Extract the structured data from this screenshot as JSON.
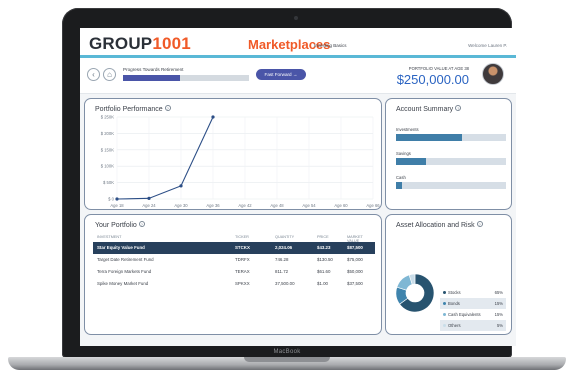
{
  "device": {
    "brand_label": "MacBook"
  },
  "header": {
    "logo_text": "GROUP",
    "logo_accent": "1001",
    "app_title": "Marketplaces",
    "app_subtitle": "Investing Basics",
    "welcome": "Welcome Lauren P."
  },
  "progress": {
    "label": "Progress Towards Retirement",
    "fraction": 0.45,
    "fast_forward_label": "Fast Forward →",
    "portfolio_value_label": "PORTFOLIO VALUE AT AGE 38",
    "portfolio_value": "$250,000.00"
  },
  "performance": {
    "title": "Portfolio Performance",
    "chart_data": {
      "type": "line",
      "x": [
        "Age 18",
        "Age 24",
        "Age 30",
        "Age 36",
        "Age 42",
        "Age 48",
        "Age 54",
        "Age 60",
        "Age 66"
      ],
      "series": [
        {
          "values": [
            0,
            2000,
            40000,
            250000
          ]
        }
      ],
      "yticks": [
        "$ 0",
        "$ 50K",
        "$ 100K",
        "$ 150K",
        "$ 200K",
        "$ 250K"
      ],
      "ylim": [
        0,
        250000
      ],
      "grid": true,
      "color": "#2c4e86"
    }
  },
  "summary": {
    "title": "Account Summary",
    "items": [
      {
        "label": "Investments",
        "fill": 0.6
      },
      {
        "label": "Savings",
        "fill": 0.27
      },
      {
        "label": "Cash",
        "fill": 0.05
      }
    ]
  },
  "portfolio": {
    "title": "Your Portfolio",
    "columns": [
      "INVESTMENT",
      "TICKER",
      "QUANTITY",
      "PRICE",
      "MARKET VALUE"
    ],
    "rows": [
      {
        "name": "Star Equity Value Fund",
        "ticker": "STCKX",
        "qty": "2,024.06",
        "price": "$43.23",
        "value": "$87,500"
      },
      {
        "name": "Target Date Retirement Fund",
        "ticker": "TDRFX",
        "qty": "746.28",
        "price": "$130.50",
        "value": "$75,000"
      },
      {
        "name": "Terra Foreign Markets Fund",
        "ticker": "TERAX",
        "qty": "811.72",
        "price": "$61.60",
        "value": "$50,000"
      },
      {
        "name": "Spike Money Market Fund",
        "ticker": "SPKXX",
        "qty": "37,500.00",
        "price": "$1.00",
        "value": "$37,500"
      }
    ]
  },
  "allocation": {
    "title": "Asset Allocation and Risk",
    "items": [
      {
        "name": "Stocks",
        "pct": "65%",
        "value": 65,
        "color": "#27536f"
      },
      {
        "name": "Bonds",
        "pct": "15%",
        "value": 15,
        "color": "#3f84ad"
      },
      {
        "name": "Cash Equivalents",
        "pct": "15%",
        "value": 15,
        "color": "#7fb7d4"
      },
      {
        "name": "Others",
        "pct": "5%",
        "value": 5,
        "color": "#c9dde9"
      }
    ]
  }
}
